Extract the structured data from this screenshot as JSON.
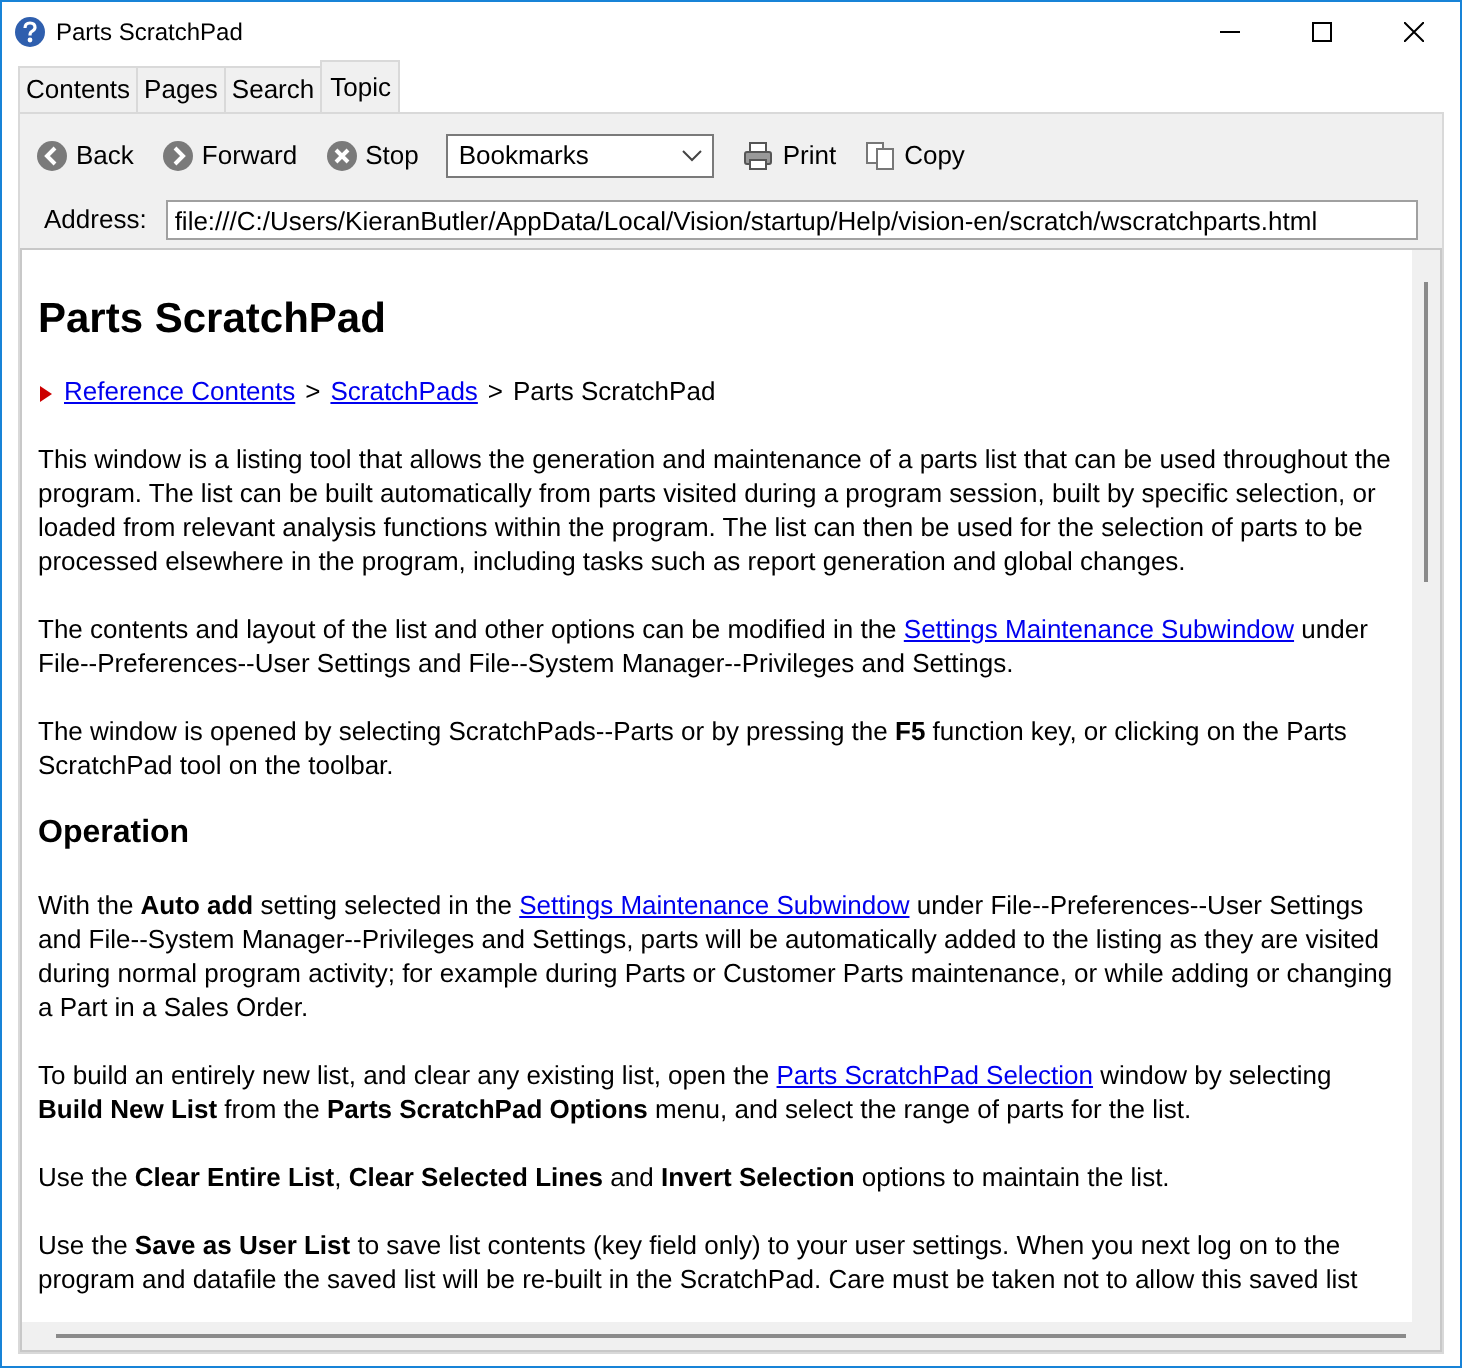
{
  "window": {
    "title": "Parts ScratchPad"
  },
  "tabs": [
    {
      "label": "Contents",
      "selected": false
    },
    {
      "label": "Pages",
      "selected": false
    },
    {
      "label": "Search",
      "selected": false
    },
    {
      "label": "Topic",
      "selected": true
    }
  ],
  "toolbar": {
    "back": "Back",
    "forward": "Forward",
    "stop": "Stop",
    "bookmarks": "Bookmarks",
    "print": "Print",
    "copy": "Copy"
  },
  "address": {
    "label": "Address:",
    "value": "file:///C:/Users/KieranButler/AppData/Local/Vision/startup/Help/vision-en/scratch/wscratchparts.html"
  },
  "page": {
    "title": "Parts ScratchPad",
    "breadcrumb_separators": [
      ">",
      ">"
    ],
    "breadcrumb": [
      {
        "text": "Reference Contents",
        "kind": "link"
      },
      {
        "text": "ScratchPads",
        "kind": "link"
      },
      {
        "text": "Parts ScratchPad",
        "kind": "text"
      }
    ],
    "blocks": [
      {
        "kind": "paragraph",
        "parts": [
          {
            "kind": "text",
            "text": "This window is a listing tool that allows the generation and maintenance of a parts list that can be used throughout the program. The list can be built automatically from parts visited during a program session, built by specific selection, or loaded from relevant analysis functions within the program. The list can then be used for the selection of parts to be processed elsewhere in the program, including tasks such as report generation and global changes."
          }
        ]
      },
      {
        "kind": "paragraph",
        "parts": [
          {
            "kind": "text",
            "text": "The contents and layout of the list and other options can be modified in the "
          },
          {
            "kind": "link",
            "text": "Settings Maintenance Subwindow"
          },
          {
            "kind": "text",
            "text": " under File--Preferences--User Settings and File--System Manager--Privileges and Settings."
          }
        ]
      },
      {
        "kind": "paragraph",
        "parts": [
          {
            "kind": "text",
            "text": "The window is opened by selecting ScratchPads--Parts or by pressing the **F5** function key, or clicking on the Parts ScratchPad tool on the toolbar."
          }
        ]
      },
      {
        "kind": "heading",
        "parts": [
          {
            "kind": "text",
            "text": "Operation"
          }
        ]
      },
      {
        "kind": "paragraph",
        "parts": [
          {
            "kind": "text",
            "text": "With the **Auto add** setting selected in the "
          },
          {
            "kind": "link",
            "text": "Settings Maintenance Subwindow"
          },
          {
            "kind": "text",
            "text": " under File--Preferences--User Settings and File--System Manager--Privileges and Settings, parts will be automatically added to the listing as they are visited during normal program activity; for example during Parts or Customer Parts maintenance, or while adding or changing a Part in a Sales Order."
          }
        ]
      },
      {
        "kind": "paragraph",
        "parts": [
          {
            "kind": "text",
            "text": "To build an entirely new list, and clear any existing list, open the "
          },
          {
            "kind": "link",
            "text": "Parts ScratchPad Selection"
          },
          {
            "kind": "text",
            "text": " window by selecting **Build New List** from the **Parts ScratchPad Options** menu, and select the range of parts for the list."
          }
        ]
      },
      {
        "kind": "paragraph",
        "parts": [
          {
            "kind": "text",
            "text": "Use the **Clear Entire List**, **Clear Selected Lines** and **Invert Selection** options to maintain the list."
          }
        ]
      },
      {
        "kind": "paragraph",
        "parts": [
          {
            "kind": "text",
            "text": "Use the **Save as User List** to save list contents (key field only) to your user settings. When you next log on to the program and datafile the saved list will be re-built in the ScratchPad. Care must be taken not to allow this saved list"
          }
        ]
      }
    ]
  }
}
